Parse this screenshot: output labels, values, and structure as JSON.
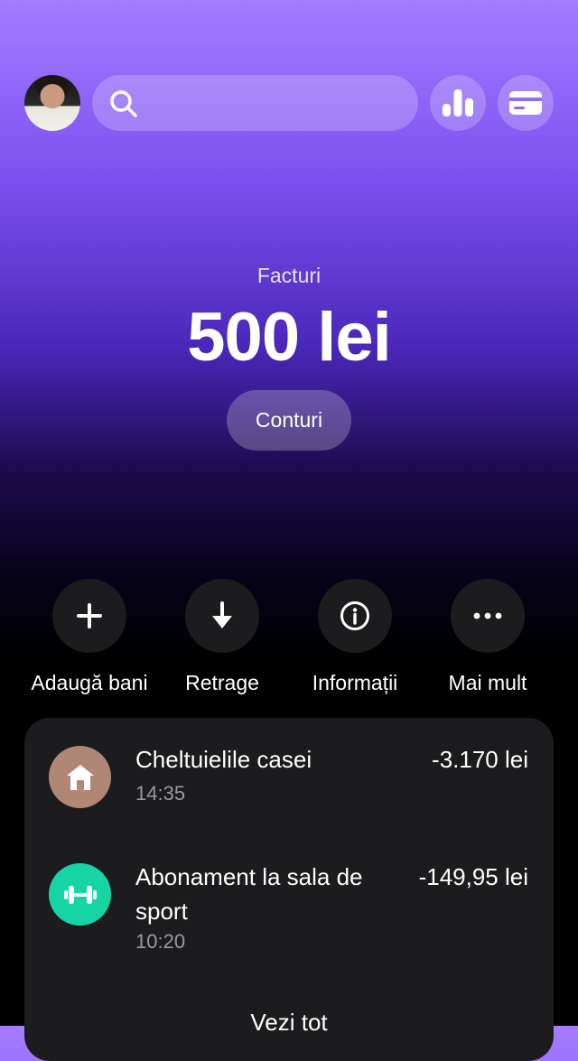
{
  "header": {
    "search": {
      "placeholder": ""
    },
    "icons": {
      "search": "search-icon",
      "stats": "bar-chart-icon",
      "card": "credit-card-icon"
    }
  },
  "balance": {
    "label": "Facturi",
    "amount": "500 lei",
    "accounts_button": "Conturi"
  },
  "actions": [
    {
      "label": "Adaugă bani",
      "icon": "plus-icon"
    },
    {
      "label": "Retrage",
      "icon": "arrow-down-icon"
    },
    {
      "label": "Informații",
      "icon": "info-icon"
    },
    {
      "label": "Mai mult",
      "icon": "more-icon"
    }
  ],
  "transactions": {
    "items": [
      {
        "title": "Cheltuielile casei",
        "time": "14:35",
        "amount": "-3.170 lei",
        "icon": "house-icon",
        "icon_color": "#b08675"
      },
      {
        "title": "Abonament la sala de sport",
        "time": "10:20",
        "amount": "-149,95 lei",
        "icon": "dumbbell-icon",
        "icon_color": "#17d4a4"
      }
    ],
    "see_all": "Vezi tot"
  },
  "colors": {
    "accent": "#7a4ff0",
    "card_bg": "#1c1c1e"
  }
}
